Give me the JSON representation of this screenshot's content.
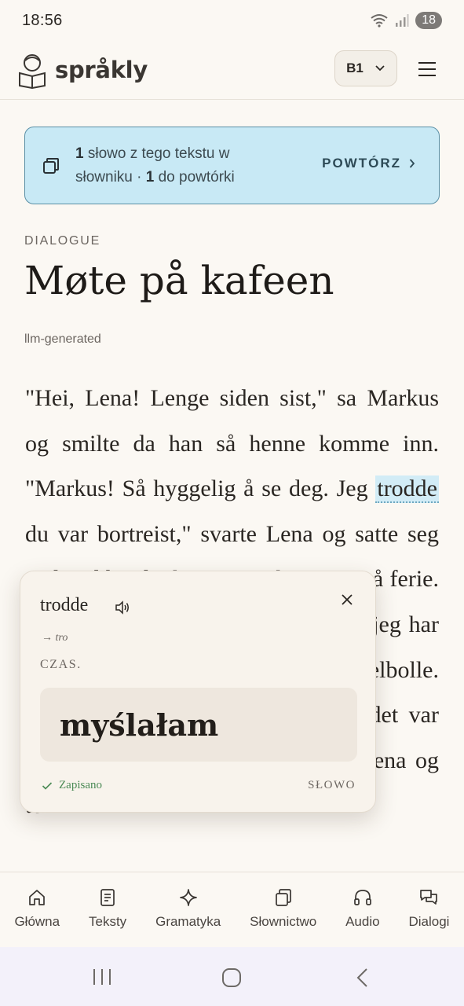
{
  "status": {
    "time": "18:56",
    "battery": "18"
  },
  "header": {
    "app_name": "språkly",
    "level": "B1"
  },
  "banner": {
    "count_words": "1",
    "text_words": " słowo z tego tekstu w słowniku · ",
    "count_review": "1",
    "text_review": " do powtórki",
    "action": "POWTÓRZ"
  },
  "article": {
    "category": "DIALOGUE",
    "title": "Møte på kafeen",
    "source": "llm-generated",
    "text_before": "\"Hei, Lena! Lenge siden sist,\" sa Markus og smilte da han så henne komme inn. \"Markus! Så hyggelig å se deg. Jeg ",
    "highlighted_word": "trodde",
    "text_after": " du var bortreist,\" svarte Lena og satte seg ned ved bordet hans. \"Jeg har vært på ferie. Har du fått deg noe å drikke?\" \"Jo, jeg har nettopp bestilt kaffe og fikk en kanelbolle. Det er deilig var en tur på hytta, det var deilig med litt frisk luft,\" fortalte Lena og tok"
  },
  "popup": {
    "word": "trodde",
    "lemma": "→ tro",
    "pos": "CZAS.",
    "translation": "myślałam",
    "saved": "Zapisano",
    "type": "SŁOWO"
  },
  "nav": [
    {
      "label": "Główna",
      "icon": "home-icon"
    },
    {
      "label": "Teksty",
      "icon": "document-icon"
    },
    {
      "label": "Gramatyka",
      "icon": "sparkle-icon"
    },
    {
      "label": "Słownictwo",
      "icon": "cards-icon"
    },
    {
      "label": "Audio",
      "icon": "headphones-icon"
    },
    {
      "label": "Dialogi",
      "icon": "chat-icon"
    }
  ]
}
